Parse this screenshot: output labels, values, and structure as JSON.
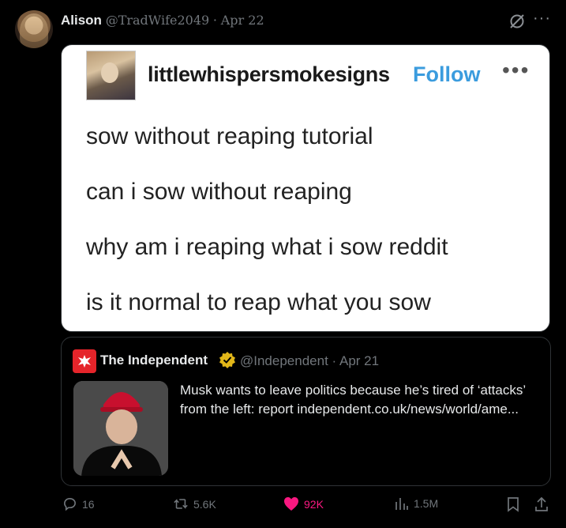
{
  "post": {
    "author_name": "Alison",
    "handle": "@TradWife2049",
    "date": "Apr 22"
  },
  "image": {
    "username": "littlewhispersmokesigns",
    "follow": "Follow",
    "lines": [
      "sow without reaping tutorial",
      "can i sow without reaping",
      "why am i reaping what i sow reddit",
      "is it normal to reap what you sow"
    ]
  },
  "quote": {
    "name": "The Independent",
    "handle": "@Independent",
    "date": "Apr 21",
    "text": "Musk wants to leave politics because he’s tired of ‘attacks’ from the left: report independent.co.uk/news/world/ame..."
  },
  "actions": {
    "replies": "16",
    "reposts": "5.6K",
    "likes": "92K",
    "views": "1.5M"
  },
  "colors": {
    "like": "#f91880",
    "follow": "#3b9cde",
    "verified": "#e2b719",
    "independent_red": "#e5242a"
  }
}
